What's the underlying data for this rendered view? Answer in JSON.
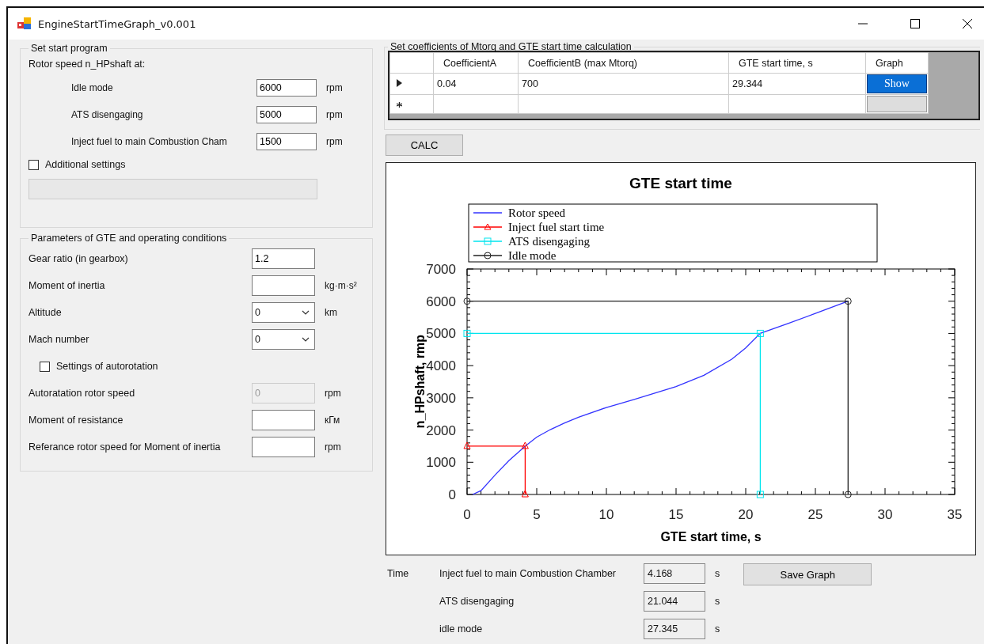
{
  "window": {
    "title": "EngineStartTimeGraph_v0.001"
  },
  "start_program": {
    "title": "Set start program",
    "heading": "Rotor speed n_HPshaft at:",
    "fields": [
      {
        "label": "Idle mode",
        "value": "6000",
        "unit": "rpm"
      },
      {
        "label": "ATS disengaging",
        "value": "5000",
        "unit": "rpm"
      },
      {
        "label": "Inject fuel to main Combustion Cham",
        "value": "1500",
        "unit": "rpm"
      }
    ],
    "additional_settings": {
      "label": "Additional settings",
      "checked": false
    }
  },
  "parameters": {
    "title": "Parameters of GTE and operating conditions",
    "rows": [
      {
        "kind": "input",
        "label": "Gear ratio (in gearbox)",
        "value": "1.2"
      },
      {
        "kind": "input",
        "label": "Moment of inertia",
        "unit": "kg·m·s²"
      },
      {
        "kind": "select",
        "label": "Altitude",
        "value": "0",
        "unit": "km"
      },
      {
        "kind": "select",
        "label": "Mach number",
        "value": "0"
      },
      {
        "kind": "checkbox",
        "label": "Settings of autorotation",
        "checked": false
      },
      {
        "kind": "input",
        "label": "Autoratation rotor speed",
        "value": "0",
        "unit": "rpm",
        "disabled": true
      },
      {
        "kind": "input",
        "label": "Moment of resistance",
        "unit": "кГм"
      },
      {
        "kind": "input",
        "label": "Referance rotor speed for Moment of inertia",
        "unit": "rpm"
      }
    ]
  },
  "coefficients": {
    "title": "Set coefficients of Mtorq and GTE start time calculation",
    "columns": [
      "CoefficientA",
      "CoefficientB (max Mtorq)",
      "GTE start time, s",
      "Graph"
    ],
    "rows": [
      {
        "kind": "current",
        "cells": [
          "0.04",
          "700",
          "29.344"
        ],
        "button": "Show"
      },
      {
        "kind": "new"
      }
    ]
  },
  "calc_button": "CALC",
  "chart": {
    "chart_data": {
      "type": "line",
      "title": "GTE start time",
      "xlabel": "GTE start time, s",
      "ylabel": "n_HPshaft, rmp",
      "legend": "top",
      "xlim": [
        0,
        35
      ],
      "ylim": [
        0,
        7000
      ],
      "xticks": [
        0,
        5,
        10,
        15,
        20,
        25,
        30,
        35
      ],
      "yticks": [
        0,
        1000,
        2000,
        3000,
        4000,
        5000,
        6000,
        7000
      ],
      "series": [
        {
          "name": "Rotor speed",
          "color": "#3333ff",
          "marker": "none",
          "x": [
            0.4,
            1,
            2,
            3,
            4.168,
            5,
            6,
            7,
            8,
            10,
            12,
            15,
            17,
            19,
            20,
            21.044,
            23,
            25,
            27.345
          ],
          "values": [
            0,
            120,
            600,
            1050,
            1500,
            1780,
            2020,
            2220,
            2400,
            2700,
            2950,
            3350,
            3700,
            4200,
            4550,
            5000,
            5300,
            5620,
            6000
          ]
        },
        {
          "name": "Inject fuel start time",
          "color": "#ff0000",
          "marker": "triangle",
          "x": [
            0,
            4.168,
            4.168
          ],
          "values": [
            1500,
            1500,
            0
          ]
        },
        {
          "name": "ATS disengaging",
          "color": "#00e5ee",
          "marker": "square",
          "x": [
            0,
            21.044,
            21.044
          ],
          "values": [
            5000,
            5000,
            0
          ]
        },
        {
          "name": "Idle mode",
          "color": "#222222",
          "marker": "circle",
          "x": [
            0,
            27.345,
            27.345
          ],
          "values": [
            6000,
            6000,
            0
          ]
        }
      ]
    }
  },
  "results": {
    "label": "Time",
    "rows": [
      {
        "label": "Inject fuel to main Combustion Chamber",
        "value": "4.168",
        "unit": "s"
      },
      {
        "label": "ATS disengaging",
        "value": "21.044",
        "unit": "s"
      },
      {
        "label": "idle mode",
        "value": "27.345",
        "unit": "s"
      }
    ],
    "save_button": "Save Graph"
  }
}
